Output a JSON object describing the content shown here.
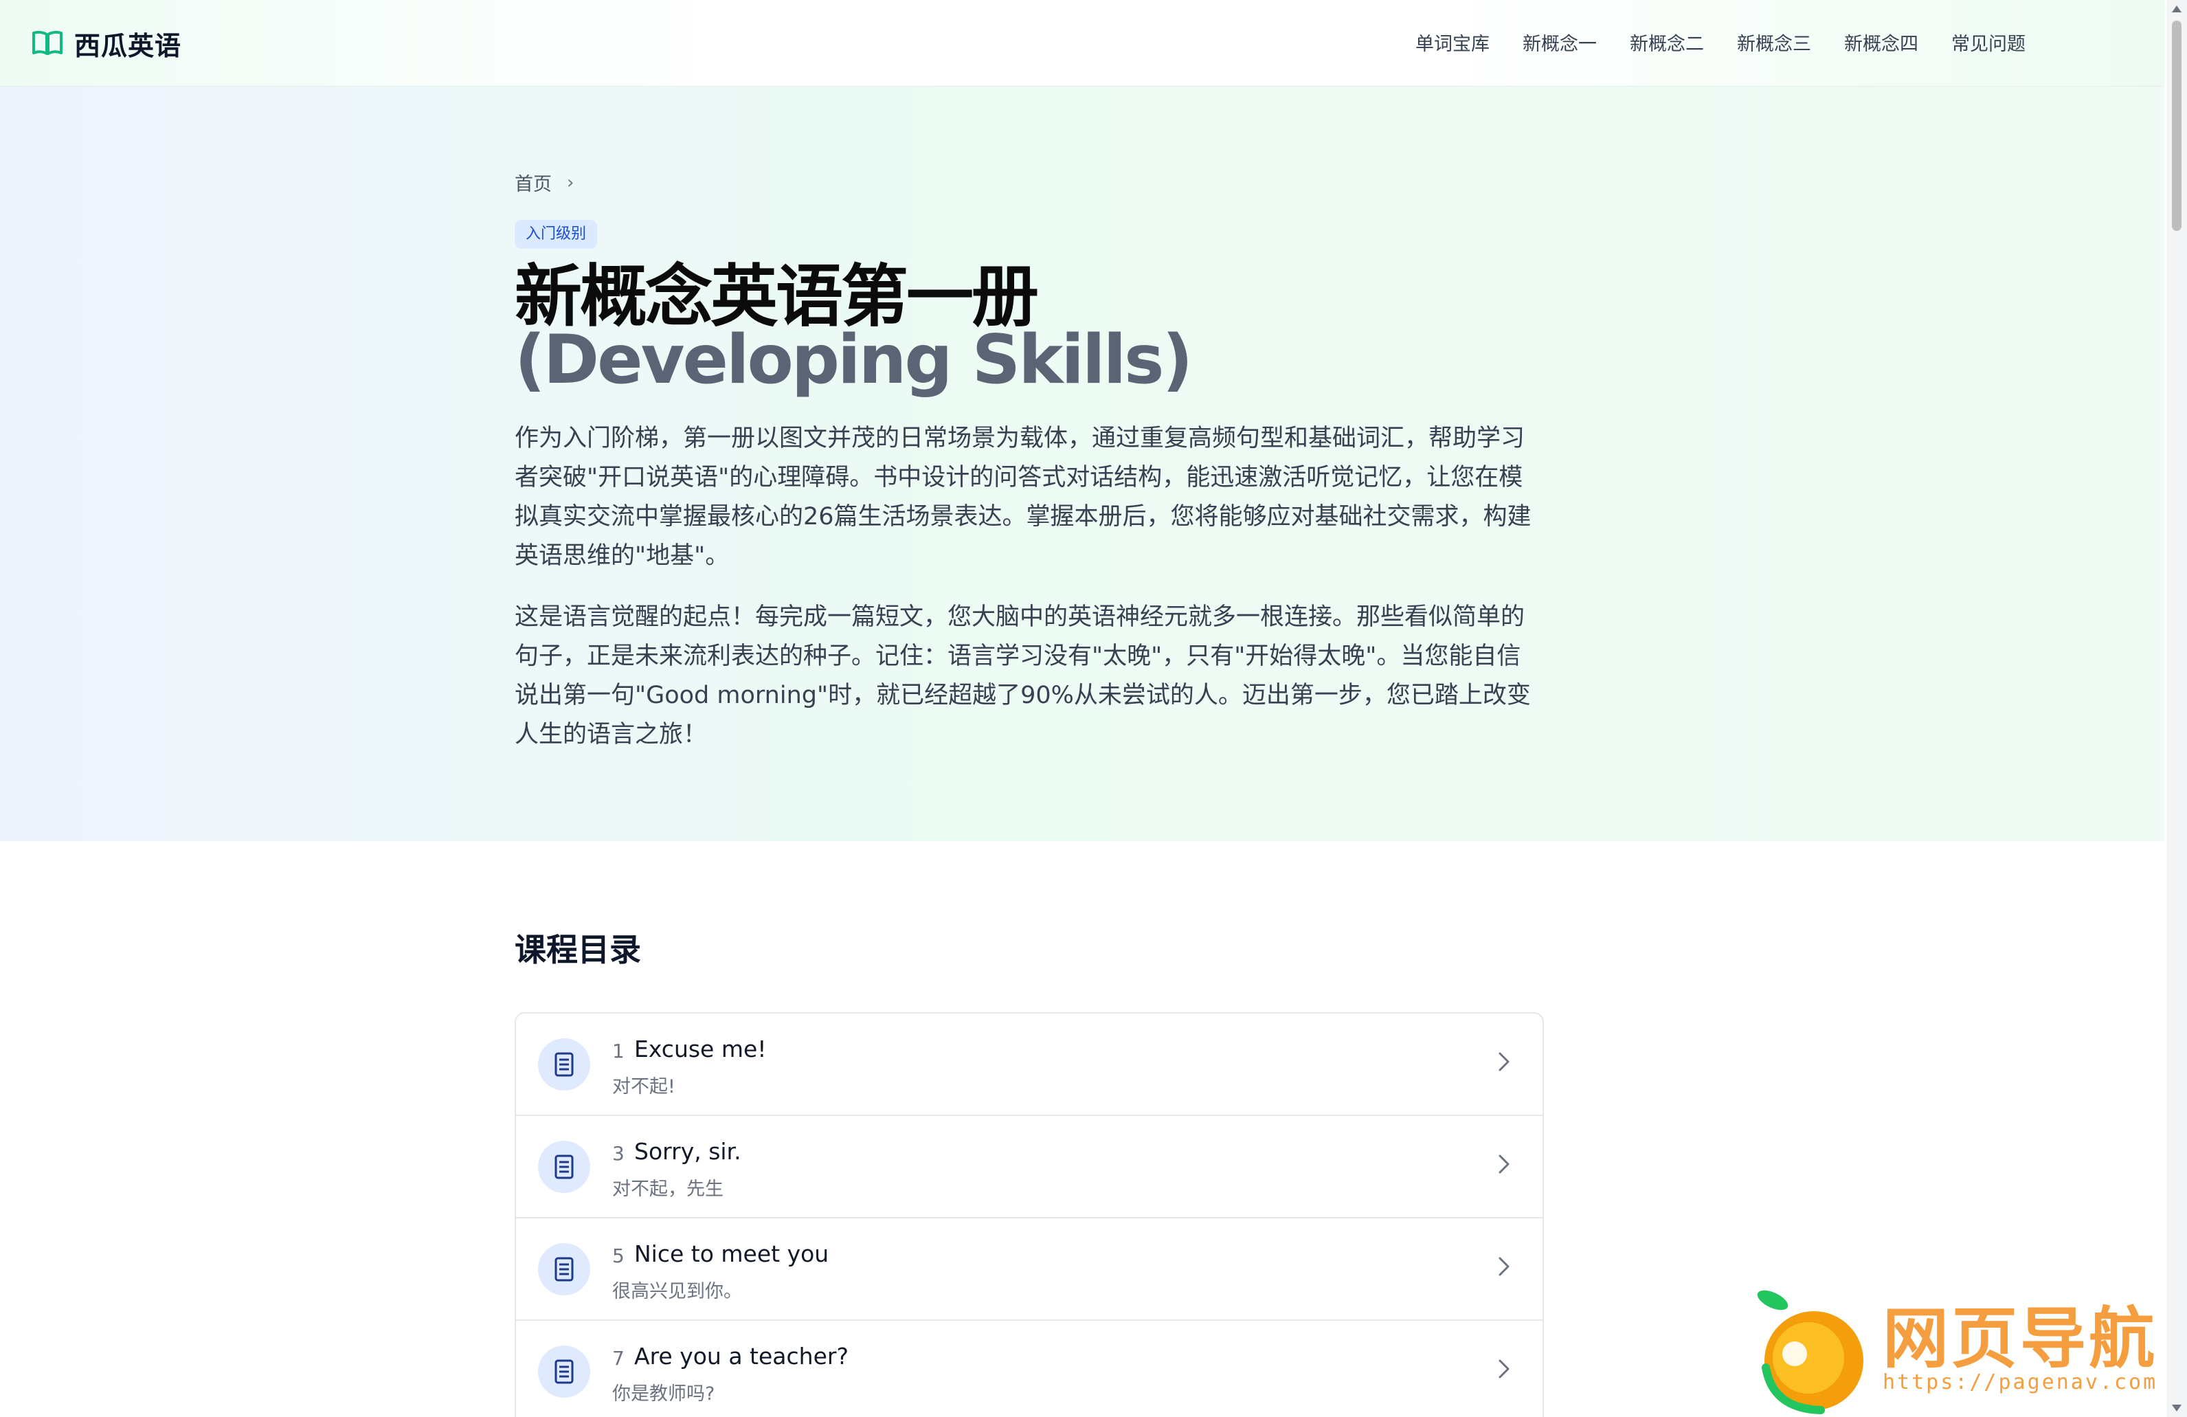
{
  "header": {
    "logo_text": "西瓜英语",
    "nav": [
      {
        "label": "单词宝库"
      },
      {
        "label": "新概念一"
      },
      {
        "label": "新概念二"
      },
      {
        "label": "新概念三"
      },
      {
        "label": "新概念四"
      },
      {
        "label": "常见问题"
      }
    ]
  },
  "hero": {
    "breadcrumb_home": "首页",
    "level_badge": "入门级别",
    "title_cn": "新概念英语第一册",
    "title_en": "(Developing Skills)",
    "description_1": "作为入门阶梯，第一册以图文并茂的日常场景为载体，通过重复高频句型和基础词汇，帮助学习者突破\"开口说英语\"的心理障碍。书中设计的问答式对话结构，能迅速激活听觉记忆，让您在模拟真实交流中掌握最核心的26篇生活场景表达。掌握本册后，您将能够应对基础社交需求，构建英语思维的\"地基\"。",
    "description_2": "这是语言觉醒的起点！每完成一篇短文，您大脑中的英语神经元就多一根连接。那些看似简单的句子，正是未来流利表达的种子。记住：语言学习没有\"太晚\"，只有\"开始得太晚\"。当您能自信说出第一句\"Good morning\"时，就已经超越了90%从未尝试的人。迈出第一步，您已踏上改变人生的语言之旅！"
  },
  "catalog": {
    "title": "课程目录",
    "lessons": [
      {
        "num": "1",
        "title": "Excuse me!",
        "subtitle": "对不起!"
      },
      {
        "num": "3",
        "title": "Sorry, sir.",
        "subtitle": "对不起，先生"
      },
      {
        "num": "5",
        "title": "Nice to meet you",
        "subtitle": "很高兴见到你。"
      },
      {
        "num": "7",
        "title": "Are you a teacher?",
        "subtitle": "你是教师吗?"
      }
    ]
  },
  "watermark": {
    "text": "网页导航",
    "url": "https://pagenav.com"
  },
  "colors": {
    "accent": "#10b981",
    "badge_bg": "#dbeafe",
    "badge_text": "#1d4ed8",
    "watermark": "#f59e3f"
  }
}
